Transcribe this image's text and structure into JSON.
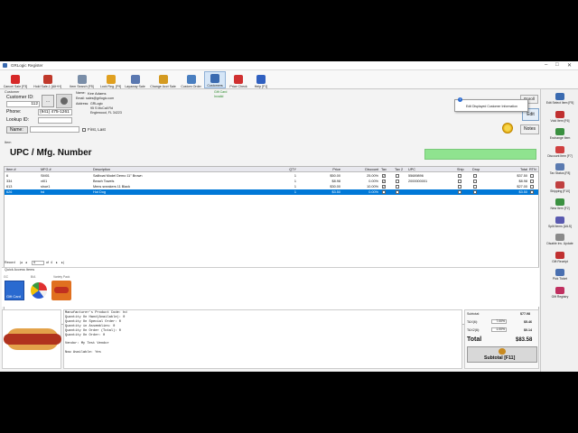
{
  "window": {
    "title": "GRLogic Register"
  },
  "toolbar": [
    {
      "label": "Cancel Sale [F3]",
      "color": "#d62828"
    },
    {
      "label": "Hold Sale-1 [Alt+H]",
      "color": "#c0392b"
    },
    {
      "label": "Item Search [F5]",
      "color": "#7a8ea8"
    },
    {
      "label": "Lock Reg. [F9]",
      "color": "#e0a020"
    },
    {
      "label": "Layaway Sale",
      "color": "#5a78b0"
    },
    {
      "label": "Change Acct Sale",
      "color": "#d49a20"
    },
    {
      "label": "Custom Order",
      "color": "#4a7fc0"
    },
    {
      "label": "Customers",
      "color": "#3a6ab0"
    },
    {
      "label": "Price Check",
      "color": "#d03030"
    },
    {
      "label": "Help [F1]",
      "color": "#3060c0"
    }
  ],
  "customer": {
    "section_label": "Customer",
    "id_label": "Customer ID:",
    "id_value": "112",
    "phone_label": "Phone:",
    "phone_value": "(941) 475-1261",
    "lookup_label": "Lookup ID:",
    "lookup_value": "",
    "name_button": "Name:",
    "name_value": "",
    "first_last_label": "First, Last",
    "name_label": "Name:",
    "name": "Kee Adams",
    "email": "Email: sales@grllogic.com",
    "address_label": "Address:",
    "address_1": "GRLogic",
    "address_2": "95 S McCall Rd",
    "address_3": "Englewood, FL  34223",
    "gift_card_line1": "Gift Card",
    "gift_card_line2": "Invalid",
    "enroll_label": "Enroll",
    "edit_label": "Edit",
    "notes_label": "Notes",
    "tooltip": "Edit Displayed Customer Information"
  },
  "item": {
    "section_label": "Item",
    "upc_label": "UPC / Mfg. Number",
    "upc_value": "",
    "upc_color": "#8fe38f"
  },
  "grid": {
    "headers": [
      "Item #",
      "MFG #",
      "Description",
      "QTY",
      "Price",
      "Discount",
      "Tax",
      "Tax 2",
      "UPC",
      "Ship",
      "Drop",
      "Total",
      "RTN"
    ],
    "rows": [
      {
        "item": "6",
        "mfg": "SM01",
        "desc": "Sailboat Model Demo 11\" Brown",
        "qty": "1",
        "price": "$50.00",
        "disc": "25.00%",
        "tax": true,
        "tax2": false,
        "upc": "55689896",
        "ship": false,
        "drop": false,
        "total": "$37.50",
        "rtn": false,
        "selected": false
      },
      {
        "item": "334",
        "mfg": "vt01",
        "desc": "Beach Towels",
        "qty": "1",
        "price": "$8.98",
        "disc": "0.00%",
        "tax": true,
        "tax2": false,
        "upc": "2000000001",
        "ship": false,
        "drop": false,
        "total": "$8.98",
        "rtn": false,
        "selected": false
      },
      {
        "item": "613",
        "mfg": "shoe1",
        "desc": "Mens sneakers 11 Black",
        "qty": "1",
        "price": "$30.00",
        "disc": "10.00%",
        "tax": true,
        "tax2": false,
        "upc": "",
        "ship": false,
        "drop": false,
        "total": "$27.00",
        "rtn": false,
        "selected": false
      },
      {
        "item": "626",
        "mfg": "hd",
        "desc": "Hot Dog",
        "qty": "1",
        "price": "$3.50",
        "disc": "0.00%",
        "tax": true,
        "tax2": false,
        "upc": "",
        "ship": false,
        "drop": false,
        "total": "$3.50",
        "rtn": false,
        "selected": true
      }
    ],
    "record_label": "Record",
    "record_of": "4",
    "record_total": "4"
  },
  "quick_access": {
    "label": "Quick Access Items",
    "tabs": [
      "GC",
      "B/A",
      "Variety Pack"
    ],
    "tiles": [
      {
        "name": "gift-card-tile",
        "text": "Gift Card"
      },
      {
        "name": "beach-ball-tile",
        "text": ""
      },
      {
        "name": "food-tile",
        "text": ""
      }
    ]
  },
  "item_detail": {
    "lines": [
      "Manufacturer's Product Code: hd",
      "Quantity On Hand(Available): 0",
      "Quantity On Special Order:   0",
      "Quantity in Assemblies:      0",
      "Quantity On Order (Total):   0",
      "Quantity On Order:           0",
      "",
      "Vendor: My Test Vendor",
      "",
      "Now Available:          Yes"
    ]
  },
  "totals": {
    "subtotal_label": "Subtotal:",
    "subtotal": "$77.98",
    "tax1_label": "TAX(6):",
    "tax1_rate": "7.00%",
    "tax1": "$5.46",
    "tax2_label": "TAX2(8):",
    "tax2_rate": "1.00%",
    "tax2": "$0.14",
    "total_label": "Total",
    "total": "$83.58",
    "subtotal_button": "Subtotal [F11]"
  },
  "sidebar": [
    {
      "label": "Edit Select Item [F5]",
      "color": "#3a6ab0"
    },
    {
      "label": "Void Item [F6]",
      "color": "#c03030"
    },
    {
      "label": "Exchange Item",
      "color": "#3a9040"
    },
    {
      "label": "Discount Item [F7]",
      "color": "#d04040"
    },
    {
      "label": "Tax Status [F8]",
      "color": "#5a7ab0"
    },
    {
      "label": "Shipping [F10]",
      "color": "#c04040"
    },
    {
      "label": "New Item [F2]",
      "color": "#3a9040"
    },
    {
      "label": "Split Items [Alt-S]",
      "color": "#5a5ab0"
    },
    {
      "label": "Disable Inv. Update",
      "color": "#8a8a8a"
    },
    {
      "label": "Gift Receipt",
      "color": "#c03030"
    },
    {
      "label": "Pick Ticket",
      "color": "#4a70b0"
    },
    {
      "label": "Gift Registry",
      "color": "#c03060"
    }
  ]
}
